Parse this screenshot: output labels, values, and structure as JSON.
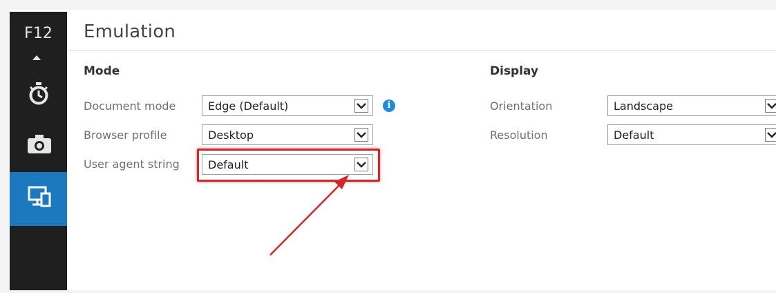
{
  "sidebar": {
    "title": "F12",
    "items": [
      {
        "name": "performance",
        "icon": "stopwatch-icon"
      },
      {
        "name": "memory",
        "icon": "camera-icon"
      },
      {
        "name": "emulation",
        "icon": "devices-icon",
        "active": true
      }
    ]
  },
  "header": {
    "title": "Emulation"
  },
  "mode": {
    "title": "Mode",
    "document_mode": {
      "label": "Document mode",
      "value": "Edge (Default)"
    },
    "browser_profile": {
      "label": "Browser profile",
      "value": "Desktop"
    },
    "user_agent": {
      "label": "User agent string",
      "value": "Default"
    },
    "info_glyph": "i"
  },
  "display": {
    "title": "Display",
    "orientation": {
      "label": "Orientation",
      "value": "Landscape"
    },
    "resolution": {
      "label": "Resolution",
      "value": "Default"
    }
  },
  "colors": {
    "sidebar_bg": "#1f1f1f",
    "accent": "#1c79c0",
    "annotation": "#d92525",
    "info": "#1d8ce0"
  }
}
